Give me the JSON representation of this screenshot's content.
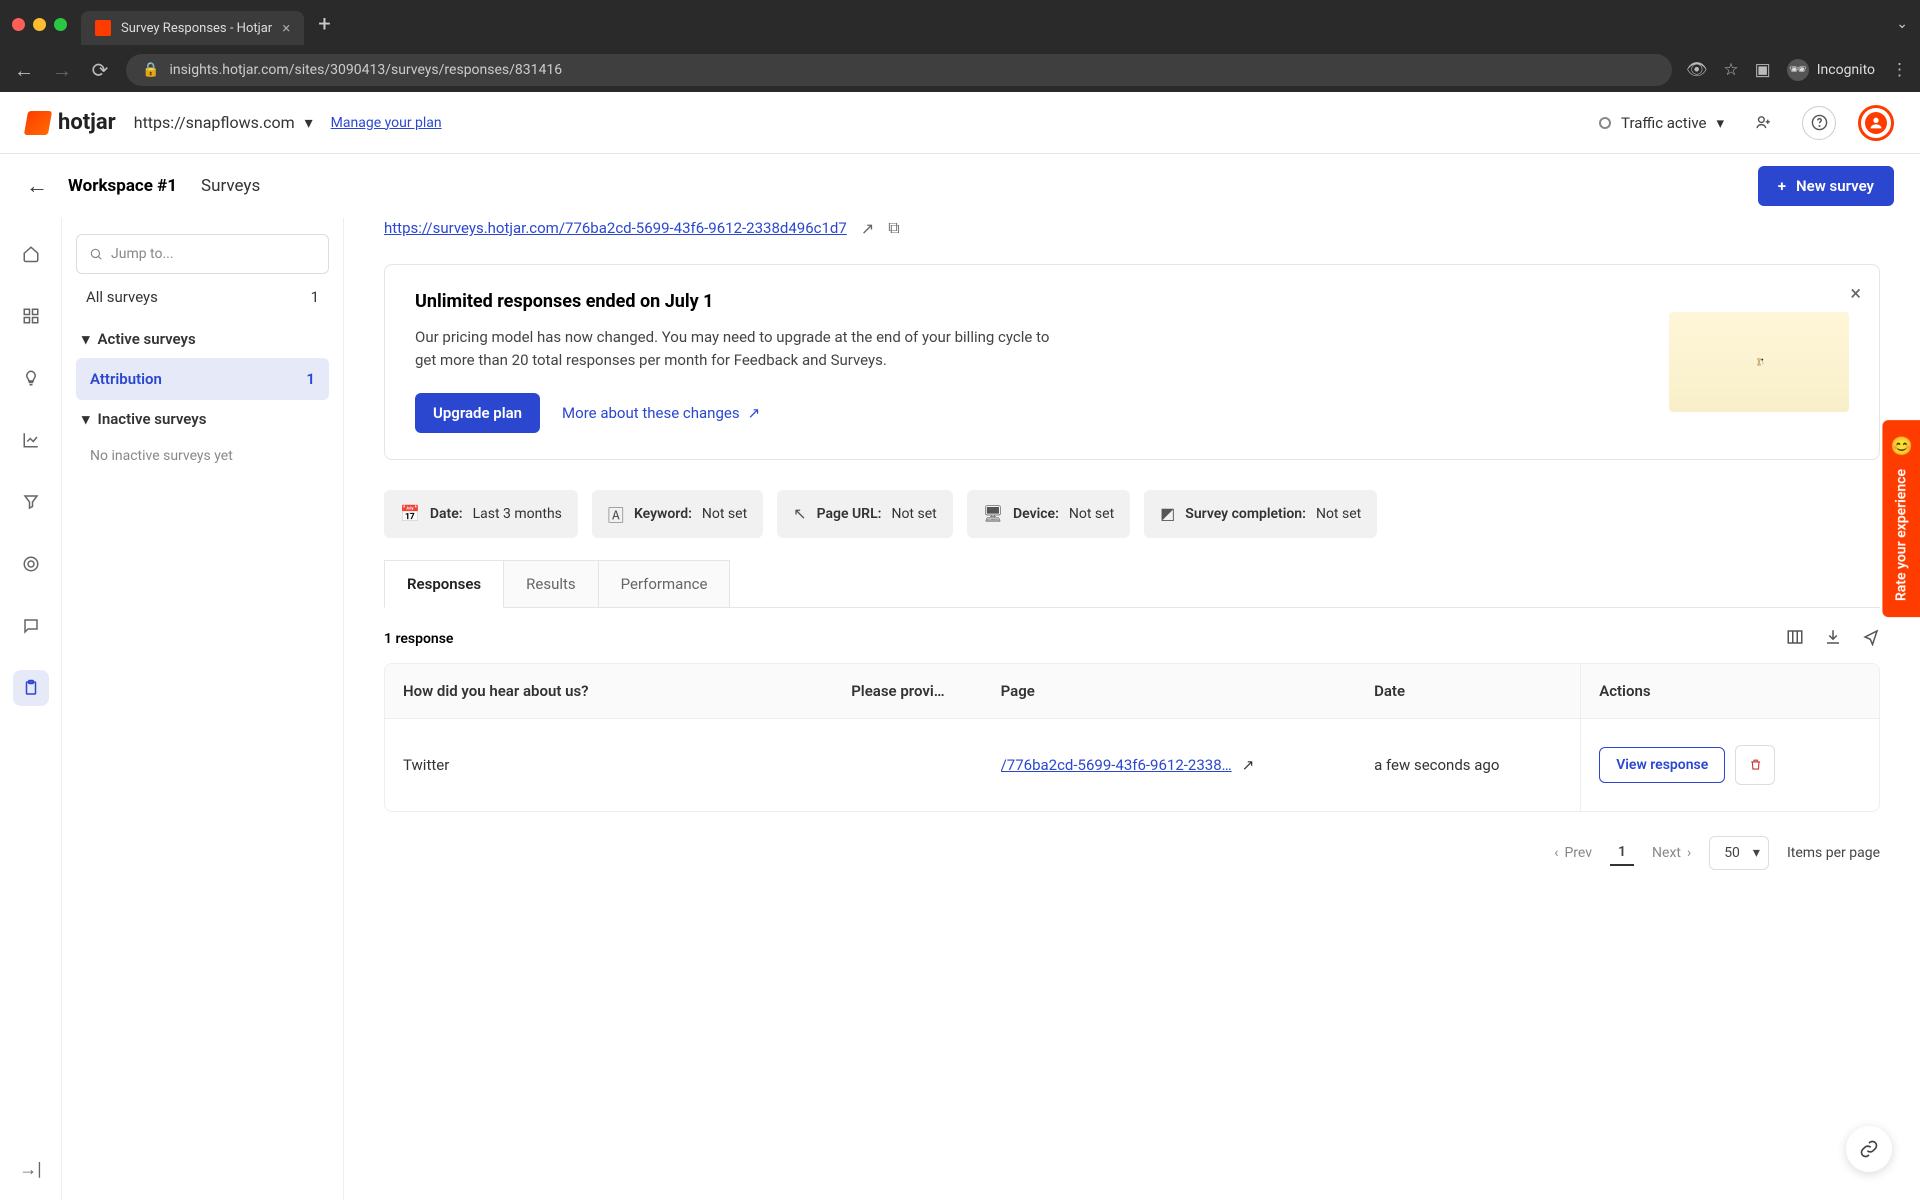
{
  "browser": {
    "tab_title": "Survey Responses - Hotjar",
    "url": "insights.hotjar.com/sites/3090413/surveys/responses/831416",
    "incognito_label": "Incognito"
  },
  "topbar": {
    "logo_text": "hotjar",
    "site_label": "https://snapflows.com",
    "manage_plan": "Manage your plan",
    "traffic_label": "Traffic active"
  },
  "breadcrumb": {
    "workspace": "Workspace #1",
    "section": "Surveys",
    "new_survey": "New survey"
  },
  "sidebar": {
    "jump_placeholder": "Jump to...",
    "all_surveys_label": "All surveys",
    "all_surveys_count": "1",
    "active_group": "Active surveys",
    "inactive_group": "Inactive surveys",
    "active_items": [
      {
        "label": "Attribution",
        "count": "1"
      }
    ],
    "inactive_empty": "No inactive surveys yet"
  },
  "survey_link": "https://surveys.hotjar.com/776ba2cd-5699-43f6-9612-2338d496c1d7",
  "banner": {
    "title": "Unlimited responses ended on July 1",
    "body": "Our pricing model has now changed. You may need to upgrade at the end of your billing cycle to get more than 20 total responses per month for Feedback and Surveys.",
    "upgrade": "Upgrade plan",
    "learn": "More about these changes"
  },
  "filters": [
    {
      "icon": "calendar",
      "label": "Date:",
      "value": "Last 3 months"
    },
    {
      "icon": "keyword",
      "label": "Keyword:",
      "value": "Not set"
    },
    {
      "icon": "pageurl",
      "label": "Page URL:",
      "value": "Not set"
    },
    {
      "icon": "device",
      "label": "Device:",
      "value": "Not set"
    },
    {
      "icon": "completion",
      "label": "Survey completion:",
      "value": "Not set"
    }
  ],
  "tabs": {
    "responses": "Responses",
    "results": "Results",
    "performance": "Performance"
  },
  "table": {
    "count_label": "1 response",
    "columns": {
      "q1": "How did you hear about us?",
      "q2": "Please provi…",
      "page": "Page",
      "date": "Date",
      "actions": "Actions"
    },
    "rows": [
      {
        "answer": "Twitter",
        "provide": "",
        "page": "/776ba2cd-5699-43f6-9612-2338…",
        "date": "a few seconds ago",
        "view": "View response"
      }
    ]
  },
  "pager": {
    "prev": "Prev",
    "next": "Next",
    "current": "1",
    "ipp_value": "50",
    "ipp_label": "Items per page"
  },
  "feedback_tab": "Rate your experience"
}
